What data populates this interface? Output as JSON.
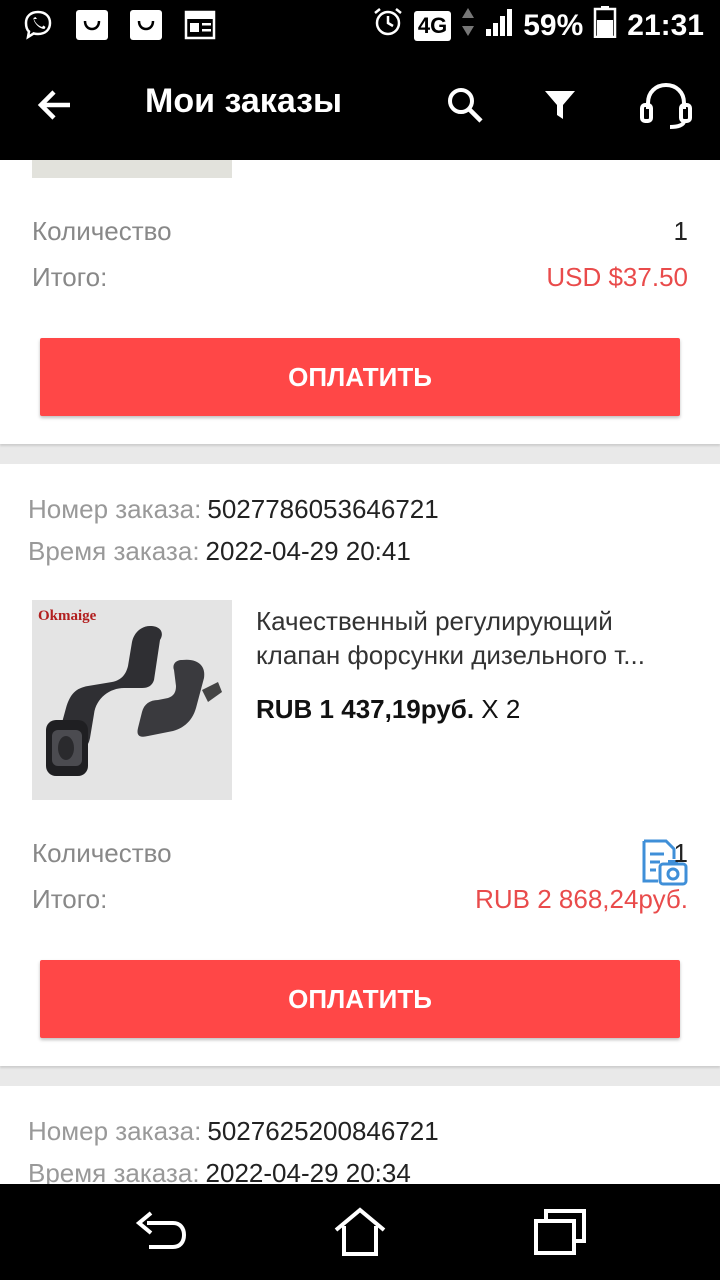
{
  "status_bar": {
    "battery": "59%",
    "time": "21:31",
    "network": "4G",
    "icons": [
      "viber-icon",
      "shopping-bag-icon",
      "shopping-bag-icon",
      "news-icon",
      "alarm-icon",
      "signal-icon",
      "battery-icon"
    ]
  },
  "app_bar": {
    "title": "Мои заказы",
    "icons": [
      "back-arrow-icon",
      "search-icon",
      "filter-icon",
      "headset-icon"
    ]
  },
  "orders": [
    {
      "quantity_label": "Количество",
      "quantity": "1",
      "total_label": "Итого:",
      "total": "USD $37.50",
      "pay_label": "ОПЛАТИТЬ"
    },
    {
      "number_label": "Номер заказа:",
      "number": "5027786053646721",
      "time_label": "Время заказа:",
      "time": "2022-04-29 20:41",
      "product": {
        "image_logo": "Okmaige",
        "title": "Качественный регулирующий клапан форсунки дизельного т...",
        "price": "RUB 1 437,19руб.",
        "qty": "X 2"
      },
      "quantity_label": "Количество",
      "quantity": "1",
      "total_label": "Итого:",
      "total": "RUB 2 868,24руб.",
      "pay_label": "ОПЛАТИТЬ"
    },
    {
      "number_label": "Номер заказа:",
      "number": "5027625200846721",
      "time_label": "Время заказа:",
      "time": "2022-04-29 20:34"
    }
  ],
  "colors": {
    "accent": "#ff4747",
    "price_red": "#e94b4b",
    "icon_blue": "#3f8fd8"
  },
  "nav_bar": {
    "icons": [
      "back-nav-icon",
      "home-nav-icon",
      "recents-nav-icon"
    ]
  }
}
